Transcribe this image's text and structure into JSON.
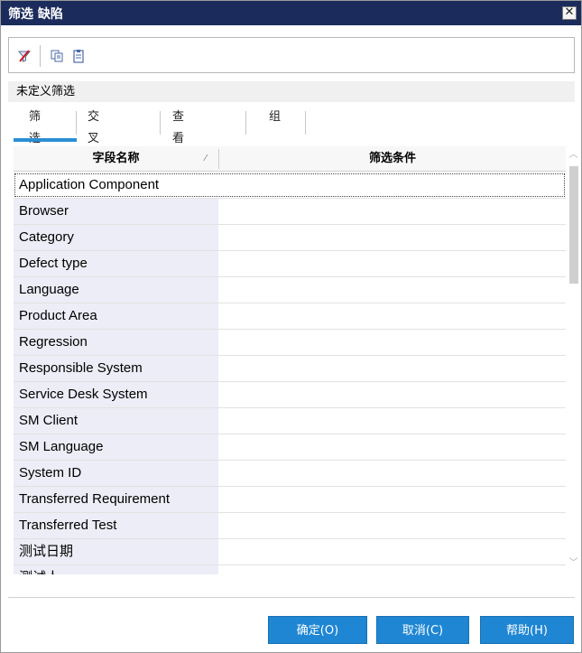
{
  "window": {
    "title": "筛选 缺陷",
    "close_glyph": "✕"
  },
  "toolbar": {
    "icons": [
      "clear-filter-icon",
      "copy-icon",
      "paste-icon"
    ]
  },
  "filter_label": "未定义筛选",
  "tabs": [
    {
      "label": "筛选",
      "active": true
    },
    {
      "label": "交叉筛选",
      "active": false
    },
    {
      "label": "查看顺序",
      "active": false
    },
    {
      "label": "组",
      "active": false
    }
  ],
  "grid": {
    "columns": [
      "字段名称",
      "筛选条件"
    ],
    "sort_indicator": "⁄",
    "rows": [
      {
        "name": "Application Component",
        "condition": ""
      },
      {
        "name": "Browser",
        "condition": ""
      },
      {
        "name": "Category",
        "condition": ""
      },
      {
        "name": "Defect type",
        "condition": ""
      },
      {
        "name": "Language",
        "condition": ""
      },
      {
        "name": "Product Area",
        "condition": ""
      },
      {
        "name": "Regression",
        "condition": ""
      },
      {
        "name": "Responsible System",
        "condition": ""
      },
      {
        "name": "Service Desk System",
        "condition": ""
      },
      {
        "name": "SM Client",
        "condition": ""
      },
      {
        "name": "SM Language",
        "condition": ""
      },
      {
        "name": "System ID",
        "condition": ""
      },
      {
        "name": "Transferred Requirement",
        "condition": ""
      },
      {
        "name": "Transferred Test",
        "condition": ""
      },
      {
        "name": "测试日期",
        "condition": ""
      },
      {
        "name": "测试人",
        "condition": ""
      }
    ],
    "selected_row": "Application Component"
  },
  "buttons": {
    "ok": "确定(O)",
    "cancel": "取消(C)",
    "help": "帮助(H)"
  },
  "colors": {
    "titlebar": "#1b2b5b",
    "accent": "#1f86d3",
    "tab_underline": "#2a8fd6",
    "name_column_bg": "#ecedf6"
  }
}
